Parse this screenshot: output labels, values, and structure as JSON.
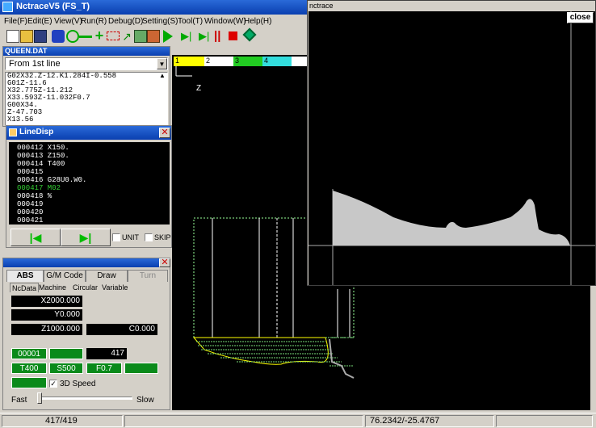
{
  "window": {
    "title": "NctraceV5 (FS_T)"
  },
  "menu": [
    "File(F)",
    "Edit(E)",
    "View(V)",
    "Run(R)",
    "Debug(D)",
    "Setting(S)",
    "Tool(T)",
    "Window(W)",
    "Help(H)"
  ],
  "queen": {
    "title": "QUEEN.DAT",
    "select_value": "From 1st line",
    "lines": [
      "G02X32.Z-12.K1.284I-0.558",
      "G01Z-11.6",
      "X32.775Z-11.212",
      "X33.593Z-11.032F0.7",
      "G00X34.",
      "Z-47.703",
      "X13.56"
    ]
  },
  "linedisp": {
    "title": "LineDisp",
    "lines": [
      "000412 X150.",
      "000413 Z150.",
      "000414 T400",
      "000415",
      "000416 G28U0.W0.",
      "000417 M02",
      "000418 %",
      "000419",
      "000420",
      "000421"
    ],
    "highlight_index": 5,
    "unit_label": "UNIT",
    "skip_label": "SKIP"
  },
  "panel": {
    "tabs": [
      "ABS",
      "G/M Code",
      "Draw",
      "Turn"
    ],
    "subtabs": [
      "NcData",
      "Machine",
      "Circular",
      "Variable"
    ],
    "x_value": "X2000.000",
    "y_value": "Y0.000",
    "z_value": "Z1000.000",
    "c_value": "C0.000",
    "seq": "00001",
    "line_no": "417",
    "tool": "T400",
    "spindle": "S500",
    "feed": "F0.7",
    "speed_label": "3D Speed",
    "fast_label": "Fast",
    "slow_label": "Slow"
  },
  "toolbar": {
    "ruler": [
      "1",
      "2",
      "3",
      "4"
    ],
    "colors": {
      "c1": "#ffff00",
      "c2": "#ffffff",
      "c3": "#22cc22",
      "c4": "#33dddd"
    }
  },
  "nctrace": {
    "title": "nctrace",
    "close_label": "close",
    "axis_label": "Z"
  },
  "status": {
    "progress": "417/419",
    "coords": "76.2342/-25.4767"
  }
}
